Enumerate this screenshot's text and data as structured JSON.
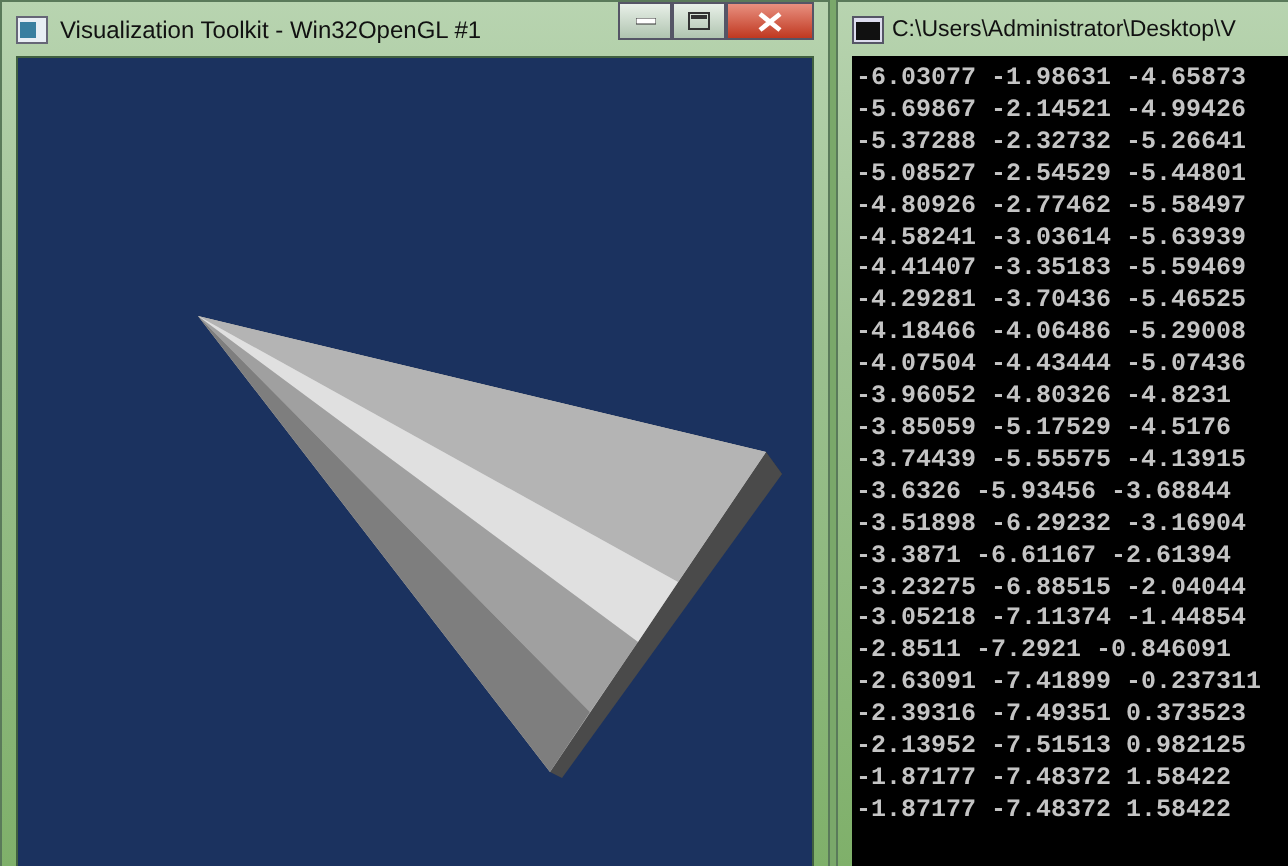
{
  "render_window": {
    "title": "Visualization Toolkit - Win32OpenGL #1"
  },
  "console_window": {
    "title": "C:\\Users\\Administrator\\Desktop\\V",
    "lines": [
      "-6.03077 -1.98631 -4.65873",
      "-5.69867 -2.14521 -4.99426",
      "-5.37288 -2.32732 -5.26641",
      "-5.08527 -2.54529 -5.44801",
      "-4.80926 -2.77462 -5.58497",
      "-4.58241 -3.03614 -5.63939",
      "-4.41407 -3.35183 -5.59469",
      "-4.29281 -3.70436 -5.46525",
      "-4.18466 -4.06486 -5.29008",
      "-4.07504 -4.43444 -5.07436",
      "-3.96052 -4.80326 -4.8231",
      "-3.85059 -5.17529 -4.5176",
      "-3.74439 -5.55575 -4.13915",
      "-3.6326 -5.93456 -3.68844",
      "-3.51898 -6.29232 -3.16904",
      "-3.3871 -6.61167 -2.61394",
      "-3.23275 -6.88515 -2.04044",
      "-3.05218 -7.11374 -1.44854",
      "-2.8511 -7.2921 -0.846091",
      "-2.63091 -7.41899 -0.237311",
      "-2.39316 -7.49351 0.373523",
      "-2.13952 -7.51513 0.982125",
      "-1.87177 -7.48372 1.58422",
      "-1.87177 -7.48372 1.58422"
    ]
  }
}
